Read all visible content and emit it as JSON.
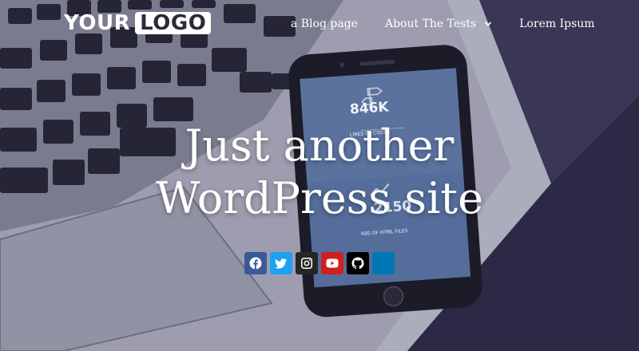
{
  "header": {
    "logo": {
      "text": "YOUR",
      "boxed": "LOGO"
    },
    "nav": [
      {
        "label": "a Blog page",
        "has_dropdown": false
      },
      {
        "label": "About The Tests",
        "has_dropdown": true
      },
      {
        "label": "Lorem Ipsum",
        "has_dropdown": false
      }
    ]
  },
  "hero": {
    "title_line1": "Just another",
    "title_line2": "WordPress site",
    "phone_screen": {
      "stat1_value": "846K",
      "stat1_label": "LINES OF CODES",
      "stat2_value": "2150",
      "stat2_label": "KBS OF HTML FILES"
    }
  },
  "social": [
    {
      "name": "facebook",
      "color": "#3b5998"
    },
    {
      "name": "twitter",
      "color": "#1da1f2"
    },
    {
      "name": "instagram",
      "color": "#262626"
    },
    {
      "name": "youtube",
      "color": "#cd201f"
    },
    {
      "name": "github",
      "color": "#000000"
    },
    {
      "name": "linkedin",
      "color": "#0077b5"
    }
  ]
}
